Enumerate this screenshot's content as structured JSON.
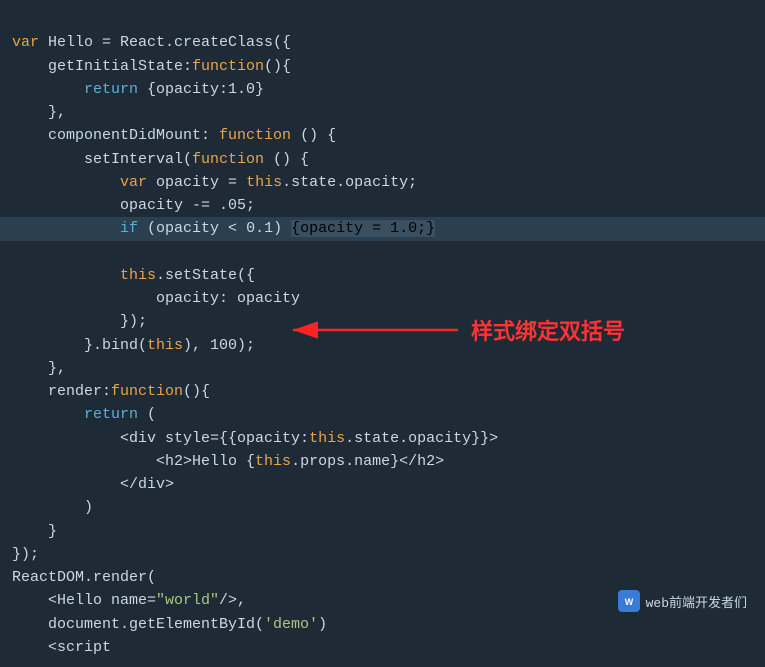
{
  "code": {
    "bg": "#1e2a35",
    "lines": []
  },
  "annotation": {
    "text": "样式绑定双括号"
  },
  "watermark": {
    "text": "web前端开发者们",
    "icon": "W"
  }
}
